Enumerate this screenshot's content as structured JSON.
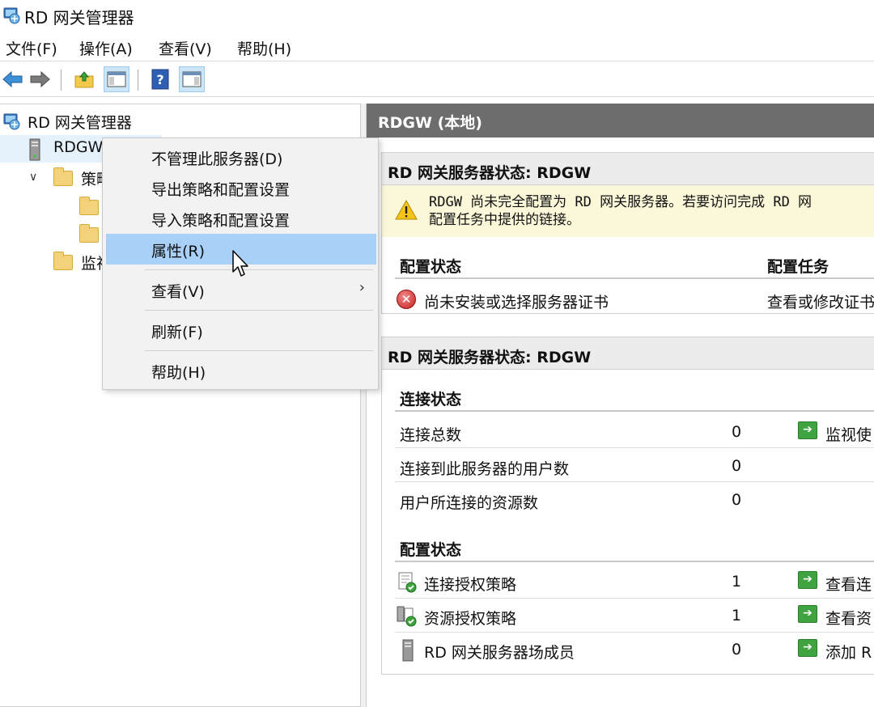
{
  "window": {
    "title": "RD 网关管理器",
    "icon": "rd-gateway-manager-icon"
  },
  "menu": [
    {
      "label": "文件(F)"
    },
    {
      "label": "操作(A)"
    },
    {
      "label": "查看(V)"
    },
    {
      "label": "帮助(H)"
    }
  ],
  "toolbar": {
    "back": "back-arrow-icon",
    "forward": "forward-arrow-icon",
    "up": "up-folder-icon",
    "show_hide": "show-hide-console-tree-icon",
    "help": "help-icon",
    "action_pane": "action-pane-icon"
  },
  "tree": {
    "root": "RD 网关管理器",
    "server": "RDGW",
    "policies": "策略",
    "monitor": "监视"
  },
  "right": {
    "header": "RDGW (本地)",
    "panel1": {
      "title": "RD 网关服务器状态: RDGW",
      "warning_line1": "RDGW 尚未完全配置为 RD 网关服务器。若要访问完成 RD 网",
      "warning_line2": "配置任务中提供的链接。",
      "col_status": "配置状态",
      "col_tasks": "配置任务",
      "row_status": "尚未安装或选择服务器证书",
      "row_task": "查看或修改证书"
    },
    "panel2": {
      "title": "RD 网关服务器状态: RDGW",
      "conn_section": "连接状态",
      "conn_rows": [
        {
          "label": "连接总数",
          "value": "0",
          "action": "监视使"
        },
        {
          "label": "连接到此服务器的用户数",
          "value": "0"
        },
        {
          "label": "用户所连接的资源数",
          "value": "0"
        }
      ],
      "config_section": "配置状态",
      "config_rows": [
        {
          "label": "连接授权策略",
          "value": "1",
          "action": "查看连"
        },
        {
          "label": "资源授权策略",
          "value": "1",
          "action": "查看资"
        },
        {
          "label": "RD 网关服务器场成员",
          "value": "0",
          "action": "添加 R"
        }
      ]
    }
  },
  "context_menu": {
    "items": [
      {
        "label": "不管理此服务器(D)"
      },
      {
        "label": "导出策略和配置设置"
      },
      {
        "label": "导入策略和配置设置"
      },
      {
        "label": "属性(R)"
      },
      {
        "label": "查看(V)"
      },
      {
        "label": "刷新(F)"
      },
      {
        "label": "帮助(H)"
      }
    ],
    "highlighted": "属性(R)"
  },
  "colors": {
    "header_bg": "#6d6d6d",
    "menu_highlight": "#a9d1f7",
    "warning_bg": "#fbf7d9",
    "go_green": "#3fa33f"
  }
}
